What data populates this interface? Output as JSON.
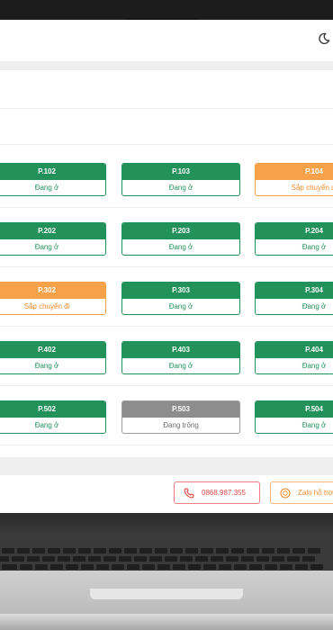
{
  "rooms": {
    "r102": {
      "code": "P.102",
      "status": "Đang ở"
    },
    "r103": {
      "code": "P.103",
      "status": "Đang ở"
    },
    "r104": {
      "code": "P.104",
      "status": "Sắp chuyển đi"
    },
    "r202": {
      "code": "P.202",
      "status": "Đang ở"
    },
    "r203": {
      "code": "P.203",
      "status": "Đang ở"
    },
    "r204": {
      "code": "P.204",
      "status": "Đang ở"
    },
    "r302": {
      "code": "P.302",
      "status": "Sắp chuyển đi"
    },
    "r303": {
      "code": "P.303",
      "status": "Đang ở"
    },
    "r304": {
      "code": "P.304",
      "status": "Đang ở"
    },
    "r402": {
      "code": "P.402",
      "status": "Đang ở"
    },
    "r403": {
      "code": "P.403",
      "status": "Đang ở"
    },
    "r404": {
      "code": "P.404",
      "status": "Đang ở"
    },
    "r502": {
      "code": "P.502",
      "status": "Đang ở"
    },
    "r503": {
      "code": "P.503",
      "status": "Đang trống"
    },
    "r504": {
      "code": "P.504",
      "status": "Đang ở"
    }
  },
  "contact": {
    "phone": "0868.987.355",
    "zalo": "Zalo hỗ trợ"
  },
  "icons": {
    "theme": "moon-icon",
    "phone": "phone-icon",
    "zalo": "zalo-icon",
    "camera": "camera-icon"
  },
  "colors": {
    "occupied": "#22915a",
    "leaving": "#f7a24b",
    "vacant": "#8d8d8d",
    "phone_accent": "#e04848"
  }
}
